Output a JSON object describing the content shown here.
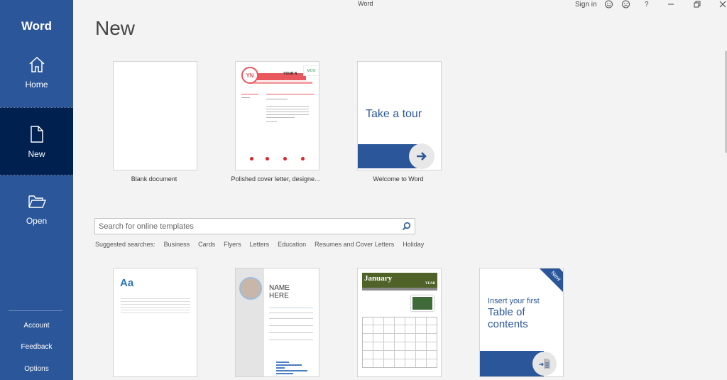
{
  "app": {
    "name": "Word",
    "window_title": "Word"
  },
  "titlebar": {
    "sign_in": "Sign in",
    "icons": [
      "smile-icon",
      "frown-icon",
      "help-icon",
      "minimize-icon",
      "restore-icon",
      "close-icon"
    ],
    "help": "?"
  },
  "sidebar": {
    "items": [
      {
        "label": "Home",
        "icon": "home-icon"
      },
      {
        "label": "New",
        "icon": "new-document-icon",
        "active": true
      },
      {
        "label": "Open",
        "icon": "folder-open-icon"
      }
    ],
    "bottom": [
      "Account",
      "Feedback",
      "Options"
    ]
  },
  "main": {
    "title": "New",
    "featured": [
      {
        "label": "Blank document"
      },
      {
        "label": "Polished cover letter, designe...",
        "preview": {
          "initials": "YN",
          "brand": "MOO",
          "heading": "YOUR N"
        }
      },
      {
        "label": "Welcome to Word",
        "preview": {
          "text": "Take a tour"
        }
      }
    ],
    "search": {
      "placeholder": "Search for online templates",
      "value": ""
    },
    "suggested": {
      "label": "Suggested searches:",
      "items": [
        "Business",
        "Cards",
        "Flyers",
        "Letters",
        "Education",
        "Resumes and Cover Letters",
        "Holiday"
      ]
    },
    "templates": [
      {
        "preview_text": "Aa"
      },
      {
        "preview_text": "NAME HERE",
        "name1": "NAME",
        "name2": "HERE"
      },
      {
        "preview_text": "January",
        "month": "January",
        "year": "YEAR"
      },
      {
        "line1": "Insert your first",
        "line2": "Table of",
        "line3": "contents",
        "badge": "New"
      }
    ]
  },
  "colors": {
    "brand": "#2b579a",
    "active_nav": "#002050",
    "calendar_green": "#4f6228",
    "cover_red": "#e8585c"
  }
}
